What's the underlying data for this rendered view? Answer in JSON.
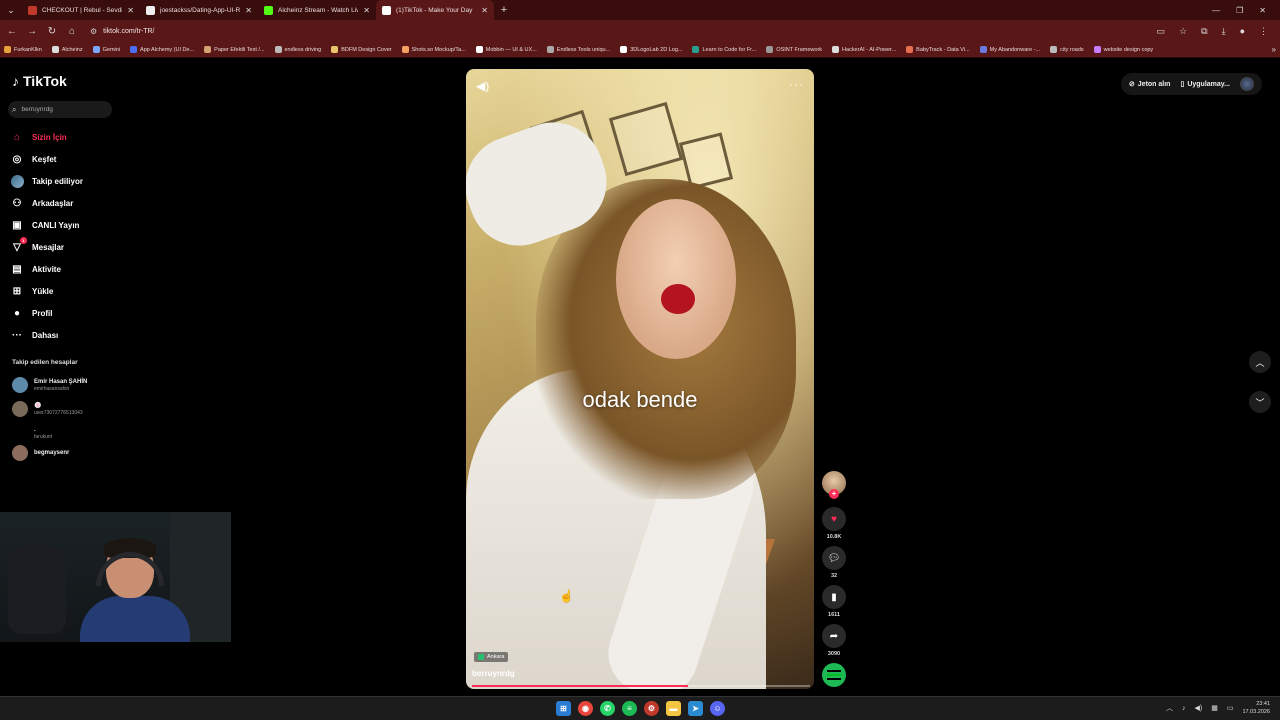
{
  "browser": {
    "tabs": [
      {
        "title": "CHECKOUT | Rebul - Sevdiğiniz",
        "color": "#c0392b",
        "active": false
      },
      {
        "title": "joestackss/Dating-App-UI-Rea",
        "color": "#eeeeee",
        "active": false
      },
      {
        "title": "Alcheinz Stream - Watch Live o",
        "color": "#53fc18",
        "active": false
      },
      {
        "title": "(1)TikTok - Make Your Day",
        "color": "#ffffff",
        "active": true
      }
    ],
    "url": "tiktok.com/tr-TR/",
    "bookmarks": [
      {
        "label": "FurkanKlkn",
        "color": "#e6a23c"
      },
      {
        "label": "Alcheinz",
        "color": "#dddddd"
      },
      {
        "label": "Gemini",
        "color": "#7aa7ff"
      },
      {
        "label": "App Alchemy (UI De...",
        "color": "#4c6ef5"
      },
      {
        "label": "Paper Efektli Text /...",
        "color": "#d4a373"
      },
      {
        "label": "endless driving",
        "color": "#bbbbbb"
      },
      {
        "label": "BDFM Design Cover",
        "color": "#e9c46a"
      },
      {
        "label": "Shots.so Mockup/Ta...",
        "color": "#f4a261"
      },
      {
        "label": "Mobbin — UI & UX...",
        "color": "#ffffff"
      },
      {
        "label": "Endless Tools uniqu...",
        "color": "#aaaaaa"
      },
      {
        "label": "3DLogoLab 2D Log...",
        "color": "#ffffff"
      },
      {
        "label": "Learn to Code for Fr...",
        "color": "#2a9d8f"
      },
      {
        "label": "OSINT Framework",
        "color": "#999999"
      },
      {
        "label": "HackerAI - AI-Power...",
        "color": "#dddddd"
      },
      {
        "label": "BabyTrack - Data Vi...",
        "color": "#e76f51"
      },
      {
        "label": "My Abandonware -...",
        "color": "#6c7ae0"
      },
      {
        "label": "city roads",
        "color": "#bbbbbb"
      },
      {
        "label": "website design copy",
        "color": "#c77dff"
      }
    ]
  },
  "tiktok": {
    "logo": "TikTok",
    "search_value": "berruynrdg",
    "nav": [
      {
        "label": "Sizin İçin",
        "icon": "home-icon",
        "glyph": "⌂",
        "active": true
      },
      {
        "label": "Keşfet",
        "icon": "compass-icon",
        "glyph": "◎",
        "active": false
      },
      {
        "label": "Takip ediliyor",
        "icon": "following-avatar-icon",
        "glyph": "",
        "active": false
      },
      {
        "label": "Arkadaşlar",
        "icon": "friends-icon",
        "glyph": "⚇",
        "active": false
      },
      {
        "label": "CANLI Yayın",
        "icon": "live-icon",
        "glyph": "▣",
        "active": false
      },
      {
        "label": "Mesajlar",
        "icon": "messages-icon",
        "glyph": "▽",
        "active": false,
        "badge": "1"
      },
      {
        "label": "Aktivite",
        "icon": "activity-icon",
        "glyph": "▤",
        "active": false
      },
      {
        "label": "Yükle",
        "icon": "upload-icon",
        "glyph": "⊞",
        "active": false
      },
      {
        "label": "Profil",
        "icon": "profile-icon",
        "glyph": "●",
        "active": false
      },
      {
        "label": "Dahası",
        "icon": "more-icon",
        "glyph": "···",
        "active": false
      }
    ],
    "following_header": "Takip edilen hesaplar",
    "accounts": [
      {
        "name": "Emir Hasan ŞAHİN",
        "handle": "emirhasansahin",
        "color": "#5d8aa8"
      },
      {
        "name": "🍥",
        "handle": "user73072776513043",
        "color": "#7a6a5a"
      },
      {
        "name": ".",
        "handle": "farukunt",
        "color": "#000000"
      },
      {
        "name": "begmaysenr",
        "handle": "",
        "color": "#8a6d5a"
      }
    ],
    "header": {
      "coins": "Jeton alın",
      "app": "Uygulamay..."
    },
    "video": {
      "caption": "odak bende",
      "location": "Ankara",
      "username": "berruynrdg",
      "progress": 0.64
    },
    "actions": {
      "likes": "10.8K",
      "comments": "32",
      "saves": "1611",
      "shares": "3090"
    }
  },
  "taskbar": {
    "time": "23:41",
    "date": "17.03.2026"
  }
}
